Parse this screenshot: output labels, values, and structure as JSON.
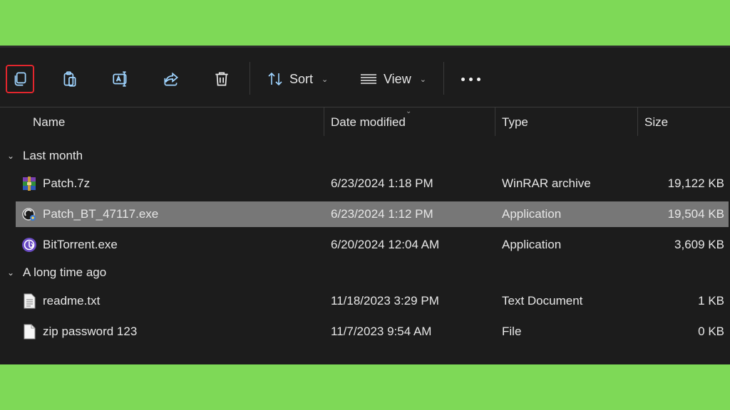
{
  "toolbar": {
    "buttons": [
      "copy-icon",
      "paste-icon",
      "rename-icon",
      "share-icon",
      "delete-icon"
    ],
    "sort_label": "Sort",
    "view_label": "View",
    "more": "more-options-icon"
  },
  "columns": {
    "name": "Name",
    "date": "Date modified",
    "type": "Type",
    "size": "Size"
  },
  "groups": [
    {
      "label": "Last month",
      "files": [
        {
          "name": "Patch.7z",
          "date": "6/23/2024 1:18 PM",
          "type": "WinRAR archive",
          "size": "19,122 KB",
          "icon": "winrar-icon"
        },
        {
          "name": "Patch_BT_47117.exe",
          "date": "6/23/2024 1:12 PM",
          "type": "Application",
          "size": "19,504 KB",
          "icon": "exe-icon"
        },
        {
          "name": "BitTorrent.exe",
          "date": "6/20/2024 12:04 AM",
          "type": "Application",
          "size": "3,609 KB",
          "icon": "bittorrent-icon"
        }
      ]
    },
    {
      "label": "A long time ago",
      "files": [
        {
          "name": "readme.txt",
          "date": "11/18/2023 3:29 PM",
          "type": "Text Document",
          "size": "1 KB",
          "icon": "text-file-icon"
        },
        {
          "name": "zip password 123",
          "date": "11/7/2023 9:54 AM",
          "type": "File",
          "size": "0 KB",
          "icon": "file-icon"
        }
      ]
    }
  ],
  "colors": {
    "background": "#7ed957",
    "window": "#1c1c1c",
    "selected_row": "#777777",
    "highlight_border": "#e3262d"
  }
}
